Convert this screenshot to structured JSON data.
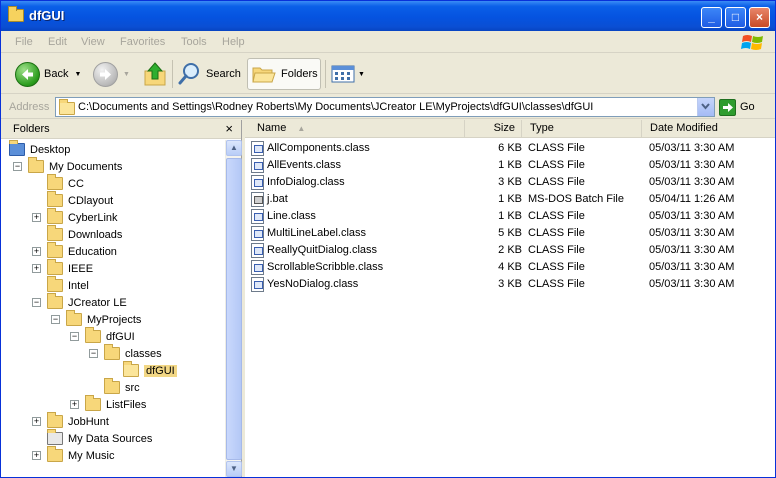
{
  "window": {
    "title": "dfGUI",
    "controls": {
      "minimize": "_",
      "maximize": "□",
      "close": "×"
    }
  },
  "menubar": {
    "items": [
      "File",
      "Edit",
      "View",
      "Favorites",
      "Tools",
      "Help"
    ]
  },
  "toolbar": {
    "back_label": "Back",
    "search_label": "Search",
    "folders_label": "Folders"
  },
  "addressbar": {
    "label": "Address",
    "path": "C:\\Documents and Settings\\Rodney Roberts\\My Documents\\JCreator LE\\MyProjects\\dfGUI\\classes\\dfGUI",
    "go_label": "Go"
  },
  "folders_pane": {
    "title": "Folders",
    "close_glyph": "×",
    "tree": [
      {
        "label": "Desktop",
        "level": 0,
        "icon": "desktop-icon",
        "expander": ""
      },
      {
        "label": "My Documents",
        "level": 1,
        "icon": "my-documents-icon",
        "expander": "−"
      },
      {
        "label": "CC",
        "level": 2,
        "icon": "folder-icon",
        "expander": ""
      },
      {
        "label": "CDlayout",
        "level": 2,
        "icon": "folder-icon",
        "expander": ""
      },
      {
        "label": "CyberLink",
        "level": 2,
        "icon": "folder-icon",
        "expander": "+"
      },
      {
        "label": "Downloads",
        "level": 2,
        "icon": "folder-icon",
        "expander": ""
      },
      {
        "label": "Education",
        "level": 2,
        "icon": "folder-icon",
        "expander": "+"
      },
      {
        "label": "IEEE",
        "level": 2,
        "icon": "folder-icon",
        "expander": "+"
      },
      {
        "label": "Intel",
        "level": 2,
        "icon": "folder-icon",
        "expander": ""
      },
      {
        "label": "JCreator LE",
        "level": 2,
        "icon": "folder-icon",
        "expander": "−"
      },
      {
        "label": "MyProjects",
        "level": 3,
        "icon": "folder-icon",
        "expander": "−"
      },
      {
        "label": "dfGUI",
        "level": 4,
        "icon": "folder-icon",
        "expander": "−"
      },
      {
        "label": "classes",
        "level": 5,
        "icon": "folder-icon",
        "expander": "−"
      },
      {
        "label": "dfGUI",
        "level": 6,
        "icon": "folder-open-icon",
        "expander": "",
        "selected": true
      },
      {
        "label": "src",
        "level": 5,
        "icon": "folder-icon",
        "expander": ""
      },
      {
        "label": "ListFiles",
        "level": 4,
        "icon": "folder-icon",
        "expander": "+"
      },
      {
        "label": "JobHunt",
        "level": 2,
        "icon": "folder-icon",
        "expander": "+"
      },
      {
        "label": "My Data Sources",
        "level": 2,
        "icon": "data-sources-icon",
        "expander": ""
      },
      {
        "label": "My Music",
        "level": 2,
        "icon": "music-folder-icon",
        "expander": "+"
      }
    ]
  },
  "filelist": {
    "columns": {
      "name": "Name",
      "size": "Size",
      "type": "Type",
      "date": "Date Modified"
    },
    "files": [
      {
        "name": "AllComponents.class",
        "size": "6 KB",
        "type": "CLASS File",
        "date": "05/03/11 3:30 AM",
        "icon": "class-file-icon"
      },
      {
        "name": "AllEvents.class",
        "size": "1 KB",
        "type": "CLASS File",
        "date": "05/03/11 3:30 AM",
        "icon": "class-file-icon"
      },
      {
        "name": "InfoDialog.class",
        "size": "3 KB",
        "type": "CLASS File",
        "date": "05/03/11 3:30 AM",
        "icon": "class-file-icon"
      },
      {
        "name": "j.bat",
        "size": "1 KB",
        "type": "MS-DOS Batch File",
        "date": "05/04/11 1:26 AM",
        "icon": "batch-file-icon"
      },
      {
        "name": "Line.class",
        "size": "1 KB",
        "type": "CLASS File",
        "date": "05/03/11 3:30 AM",
        "icon": "class-file-icon"
      },
      {
        "name": "MultiLineLabel.class",
        "size": "5 KB",
        "type": "CLASS File",
        "date": "05/03/11 3:30 AM",
        "icon": "class-file-icon"
      },
      {
        "name": "ReallyQuitDialog.class",
        "size": "2 KB",
        "type": "CLASS File",
        "date": "05/03/11 3:30 AM",
        "icon": "class-file-icon"
      },
      {
        "name": "ScrollableScribble.class",
        "size": "4 KB",
        "type": "CLASS File",
        "date": "05/03/11 3:30 AM",
        "icon": "class-file-icon"
      },
      {
        "name": "YesNoDialog.class",
        "size": "3 KB",
        "type": "CLASS File",
        "date": "05/03/11 3:30 AM",
        "icon": "class-file-icon"
      }
    ]
  },
  "colors": {
    "titlebar": "#0553e0",
    "chrome": "#ece9d8",
    "selection": "#f2d785",
    "disabled_text": "#a7a59c"
  }
}
